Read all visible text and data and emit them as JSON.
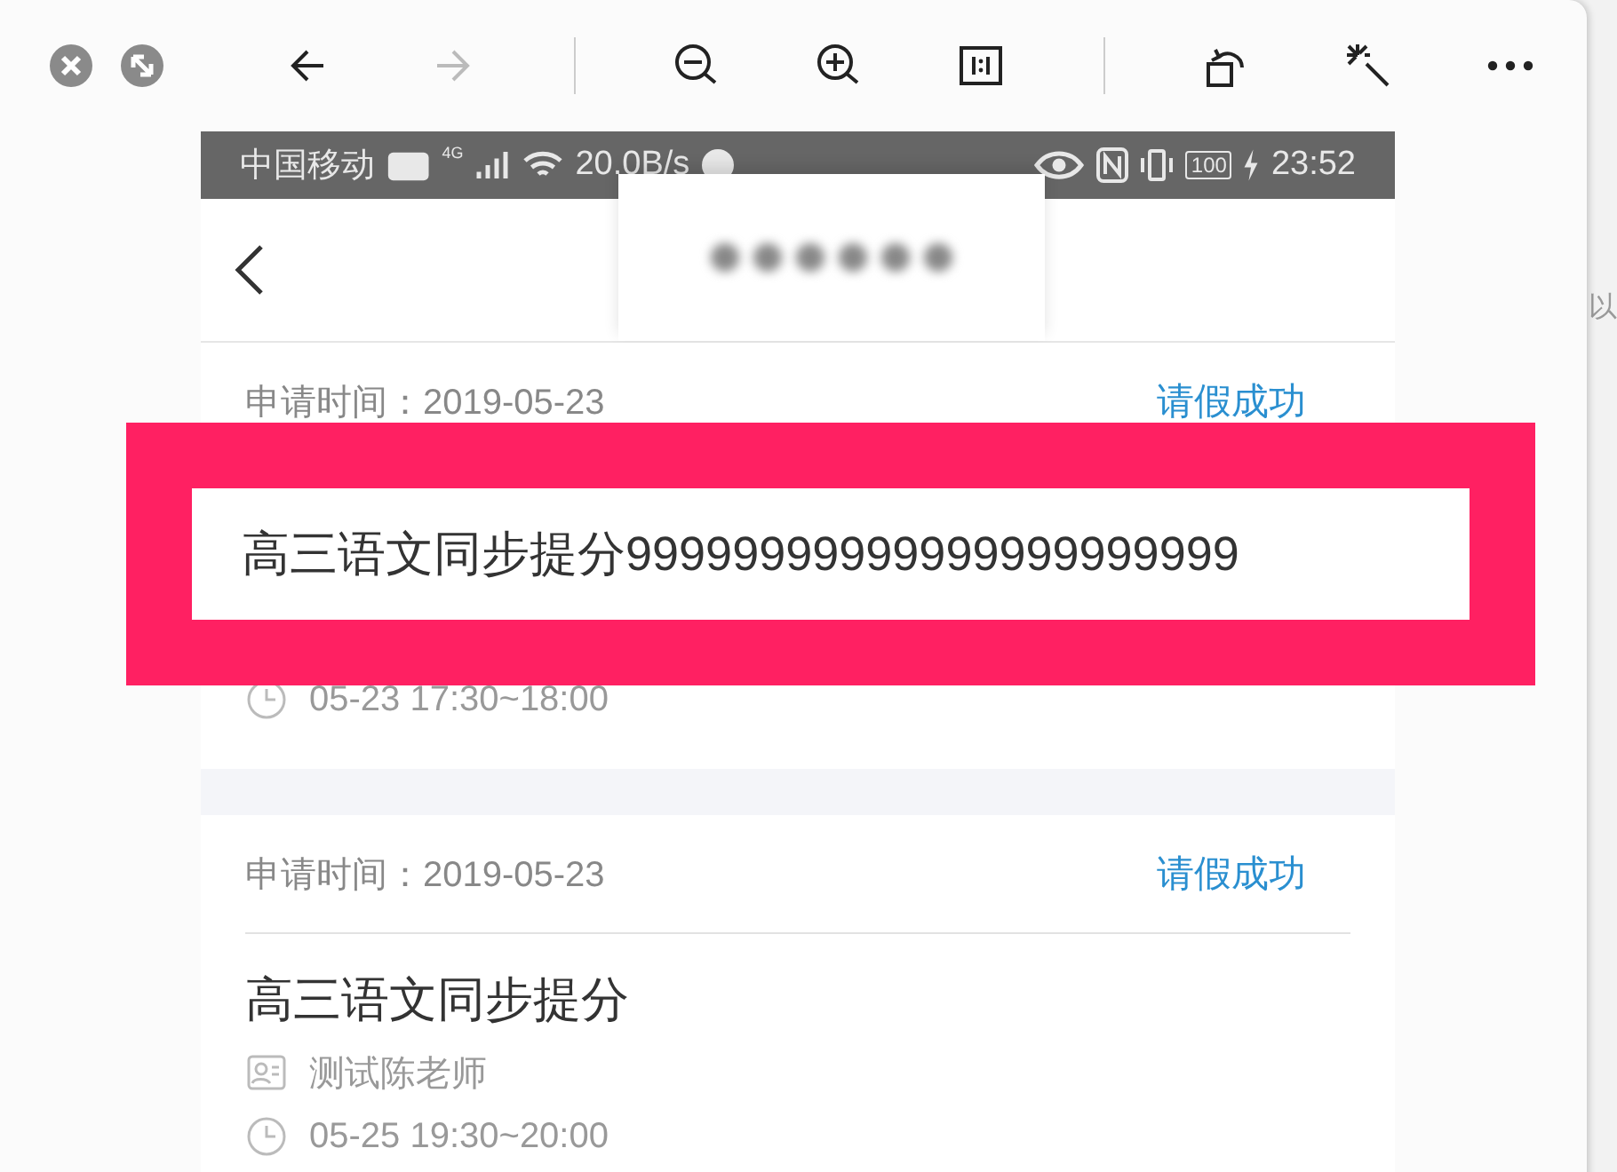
{
  "window_controls": [
    {
      "kind": "close"
    },
    {
      "kind": "minimize"
    }
  ],
  "toolbar": [
    {
      "kind": "back",
      "disabled": false
    },
    {
      "kind": "forward",
      "disabled": true
    },
    {
      "kind": "separator"
    },
    {
      "kind": "zoom-out",
      "disabled": false
    },
    {
      "kind": "zoom-in",
      "disabled": false
    },
    {
      "kind": "actual-size",
      "disabled": false
    },
    {
      "kind": "separator"
    },
    {
      "kind": "rotate",
      "disabled": false
    },
    {
      "kind": "enhance",
      "disabled": false
    },
    {
      "kind": "more",
      "disabled": false
    }
  ],
  "background_text": "以",
  "status_bar": {
    "carrier": "中国移动",
    "network": "4G",
    "speed": "20.0B/s",
    "battery": "100",
    "time": "23:52"
  },
  "cards": [
    {
      "apply_time": "申请时间：2019-05-23",
      "status": "请假成功",
      "title": "高三语文同步提分99999999999999999999999",
      "time": "05-23 17:30~18:00",
      "annotated": true
    },
    {
      "apply_time": "申请时间：2019-05-23",
      "status": "请假成功",
      "title": "高三语文同步提分",
      "teacher": "测试陈老师",
      "time": "05-25 19:30~20:00",
      "annotated": false
    }
  ]
}
